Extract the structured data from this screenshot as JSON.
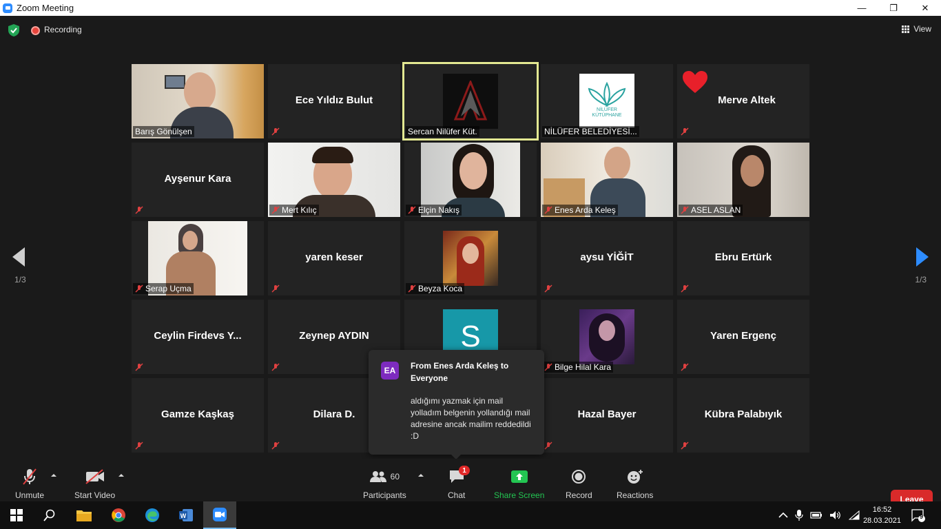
{
  "window": {
    "title": "Zoom Meeting",
    "controls": [
      "—",
      "❐",
      "✕"
    ]
  },
  "topbar": {
    "recording_label": "Recording",
    "view_label": "View"
  },
  "pages": {
    "left": "1/3",
    "right": "1/3"
  },
  "tiles": [
    {
      "name": "Barış Gönülşen",
      "video": true
    },
    {
      "name": "Ece Yıldız Bulut",
      "video": false
    },
    {
      "name": "Sercan Nilüfer Küt.",
      "video": true
    },
    {
      "name": "NİLÜFER BELEDİYESİ...",
      "video": true,
      "logo_text": "NİLÜFER",
      "logo_sub": "KÜTÜPHANE"
    },
    {
      "name": "Merve Altek",
      "video": false
    },
    {
      "name": "Ayşenur Kara",
      "video": false
    },
    {
      "name": "Mert Kılıç",
      "video": true
    },
    {
      "name": "Elçin Nakış",
      "video": true
    },
    {
      "name": "Enes Arda Keleş",
      "video": true
    },
    {
      "name": "ASEL ASLAN",
      "video": true
    },
    {
      "name": "Serap Uçma",
      "video": true
    },
    {
      "name": "yaren keser",
      "video": false
    },
    {
      "name": "Beyza Koca",
      "video": true
    },
    {
      "name": "aysu YİĞİT",
      "video": false
    },
    {
      "name": "Ebru Ertürk",
      "video": false
    },
    {
      "name": "Ceylin  Firdevs  Y...",
      "video": false
    },
    {
      "name": "Zeynep AYDIN",
      "video": false
    },
    {
      "name": "",
      "video": true,
      "avatar_letter": "S"
    },
    {
      "name": "Bilge Hilal Kara",
      "video": true
    },
    {
      "name": "Yaren Ergenç",
      "video": false
    },
    {
      "name": "Gamze Kaşkaş",
      "video": false
    },
    {
      "name": "Dilara D.",
      "video": false
    },
    {
      "name": "",
      "video": false
    },
    {
      "name": "Hazal Bayer",
      "video": false
    },
    {
      "name": "Kübra Palabıyık",
      "video": false
    }
  ],
  "chat_popup": {
    "avatar": "EA",
    "from": "From Enes Arda Keleş to Everyone",
    "message": "aldığımı yazmak için mail yolladım belgenin yollandığı mail adresine ancak mailim reddedildi :D"
  },
  "toolbar": {
    "unmute_label": "Unmute",
    "video_label": "Start Video",
    "participants_label": "Participants",
    "participants_count": "60",
    "chat_label": "Chat",
    "chat_badge": "1",
    "share_label": "Share Screen",
    "record_label": "Record",
    "reactions_label": "Reactions",
    "leave_label": "Leave"
  },
  "taskbar": {
    "time": "16:52",
    "date": "28.03.2021",
    "notif_count": "9"
  },
  "colors": {
    "zoom_blue": "#2d8cff",
    "leave_red": "#d92a2a",
    "active_border": "#e3e892",
    "share_green": "#23c552"
  }
}
